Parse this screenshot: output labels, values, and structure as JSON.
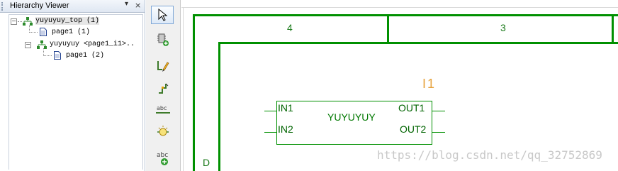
{
  "panel": {
    "title": "Hierarchy Viewer",
    "pin_glyph": "▾",
    "close_glyph": "×"
  },
  "tree": [
    {
      "label": "yuyuyuy_top (1)",
      "icon": "hierarchy-icon",
      "selected": true
    },
    {
      "label": "page1 (1)",
      "icon": "page-icon"
    },
    {
      "label": "yuyuyuy <page1_i1>..",
      "icon": "hierarchy-icon"
    },
    {
      "label": "page1 (2)",
      "icon": "page-icon"
    }
  ],
  "toolbar": [
    "pointer-icon",
    "place-part-icon",
    "draw-wire-icon",
    "place-pin-icon",
    "net-alias-icon",
    "power-icon",
    "place-text-icon"
  ],
  "schematic": {
    "zone_top_a": "4",
    "zone_top_b": "3",
    "zone_left": "D",
    "part_ref": "I1",
    "part_value": "YUYUYUY",
    "pins_left": [
      "IN1",
      "IN2"
    ],
    "pins_right": [
      "OUT1",
      "OUT2"
    ]
  },
  "watermark": "https://blog.csdn.net/qq_32752869",
  "colors": {
    "border": "#009000",
    "ref": "#e6a23c"
  }
}
